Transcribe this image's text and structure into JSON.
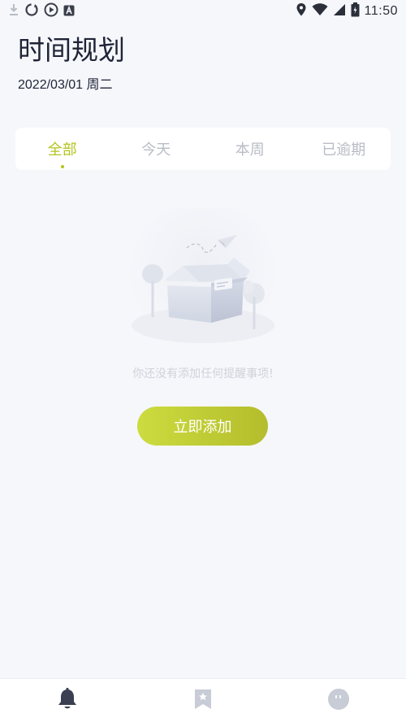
{
  "status_bar": {
    "time": "11:50",
    "left_icons": [
      "download-icon",
      "sync-icon",
      "play-icon",
      "a-icon"
    ],
    "right_icons": [
      "location-icon",
      "wifi-icon",
      "signal-icon",
      "battery-icon"
    ]
  },
  "header": {
    "title": "时间规划",
    "date": "2022/03/01 周二"
  },
  "tabs": [
    {
      "label": "全部",
      "active": true
    },
    {
      "label": "今天",
      "active": false
    },
    {
      "label": "本周",
      "active": false
    },
    {
      "label": "已逾期",
      "active": false
    }
  ],
  "empty_state": {
    "message": "你还没有添加任何提醒事项!",
    "button_label": "立即添加"
  },
  "bottom_nav": {
    "items": [
      {
        "icon": "bell-icon",
        "active": true
      },
      {
        "icon": "bookmark-icon",
        "active": false
      },
      {
        "icon": "face-icon",
        "active": false
      }
    ]
  },
  "colors": {
    "accent": "#b4c41f",
    "background": "#f6f7fb",
    "inactive": "#c8ccd6"
  }
}
